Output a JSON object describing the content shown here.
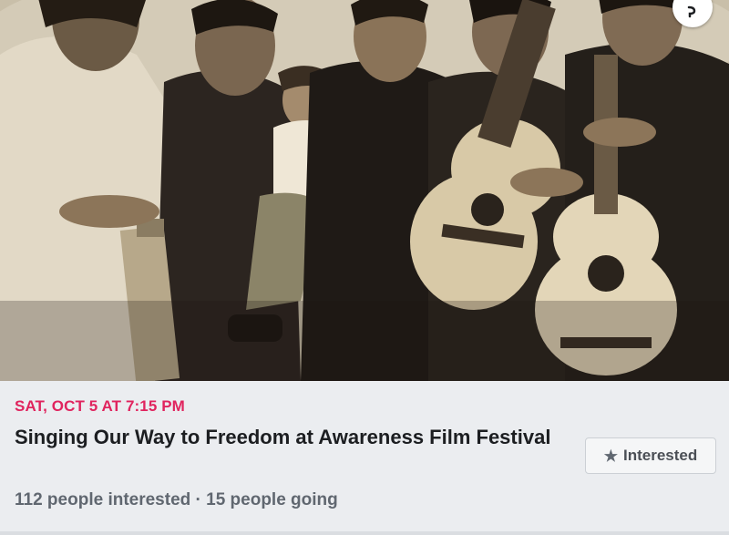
{
  "event": {
    "date": "SAT, OCT 5 AT 7:15 PM",
    "title": "Singing Our Way to Freedom at Awareness Film Festival",
    "stats": "112 people interested · 15 people going",
    "interested_label": "Interested",
    "interested_icon": "star-icon",
    "date_color": "#e0245e"
  },
  "cover": {
    "style": "sepia group photograph of men with guitars holding a child",
    "corner_button_icon": "chevron-icon"
  }
}
